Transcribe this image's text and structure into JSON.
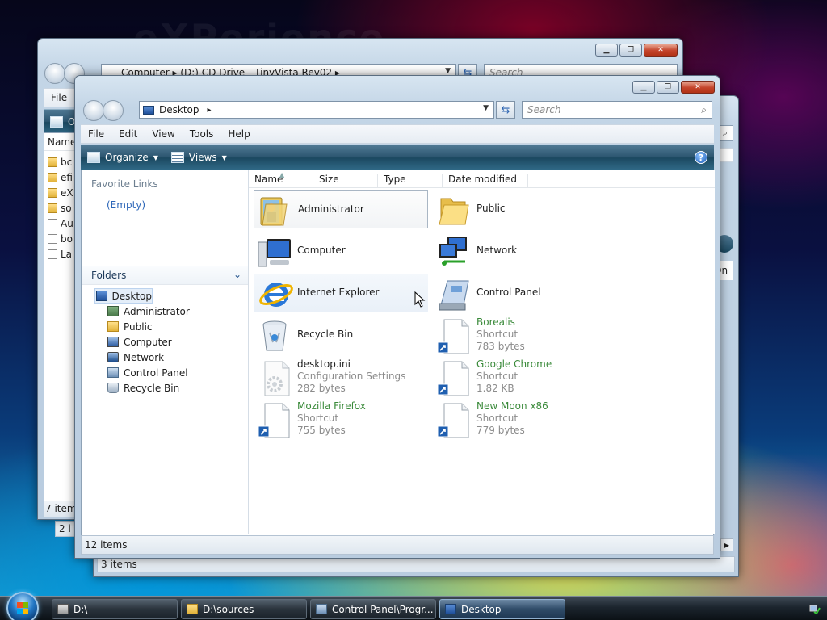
{
  "back_window_1": {
    "address": "Computer  ▸  (D:) CD Drive - TinyVista Rev02  ▸",
    "search_placeholder": "Search",
    "menu_first": "File",
    "toolbar_first": "O",
    "col_first": "Name",
    "items": [
      "bc",
      "efi",
      "eX",
      "so",
      "Au",
      "bo",
      "La"
    ],
    "status": "7 items"
  },
  "back_window_2": {
    "status_partial": "2 i",
    "status": "3 items",
    "col_partial": "On"
  },
  "main_window": {
    "address": {
      "location": "Desktop",
      "arrow": "▸"
    },
    "search_placeholder": "Search",
    "menu": [
      "File",
      "Edit",
      "View",
      "Tools",
      "Help"
    ],
    "toolbar": {
      "organize": "Organize",
      "views": "Views"
    },
    "nav": {
      "favorite_links_header": "Favorite Links",
      "favorite_links_empty": "(Empty)",
      "folders_header": "Folders",
      "tree_root": "Desktop",
      "tree_children": [
        "Administrator",
        "Public",
        "Computer",
        "Network",
        "Control Panel",
        "Recycle Bin"
      ]
    },
    "columns": [
      "Name",
      "Size",
      "Type",
      "Date modified"
    ],
    "items": [
      {
        "name": "Administrator",
        "kind": "user-folder"
      },
      {
        "name": "Public",
        "kind": "folder"
      },
      {
        "name": "Computer",
        "kind": "computer"
      },
      {
        "name": "Network",
        "kind": "network"
      },
      {
        "name": "Internet Explorer",
        "kind": "ie"
      },
      {
        "name": "Control Panel",
        "kind": "control-panel"
      },
      {
        "name": "Recycle Bin",
        "kind": "recycle-bin"
      },
      {
        "name": "Borealis",
        "type": "Shortcut",
        "size": "783 bytes"
      },
      {
        "name": "desktop.ini",
        "type": "Configuration Settings",
        "size": "282 bytes"
      },
      {
        "name": "Google Chrome",
        "type": "Shortcut",
        "size": "1.82 KB"
      },
      {
        "name": "Mozilla Firefox",
        "type": "Shortcut",
        "size": "755 bytes"
      },
      {
        "name": "New Moon x86",
        "type": "Shortcut",
        "size": "779 bytes"
      }
    ],
    "status": "12 items"
  },
  "taskbar": {
    "buttons": [
      "D:\\",
      "D:\\sources",
      "Control Panel\\Progr...",
      "Desktop"
    ]
  },
  "background_text": "eXPerience"
}
